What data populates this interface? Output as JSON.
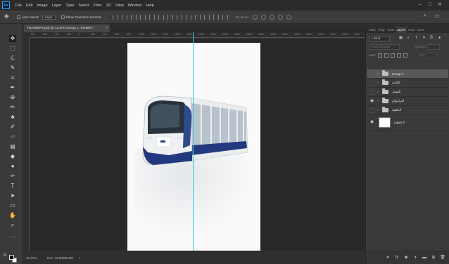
{
  "app": {
    "logo_text": "Ps"
  },
  "menu": [
    "File",
    "Edit",
    "Image",
    "Layer",
    "Type",
    "Select",
    "Filter",
    "3D",
    "View",
    "Window",
    "Help"
  ],
  "window_controls": [
    "–",
    "□",
    "✕"
  ],
  "options_bar": {
    "auto_select_label": "Auto-Select:",
    "auto_select_value": "Layer",
    "show_transform_label": "Show Transform Controls",
    "mode_3d_label": "3D Mode:"
  },
  "document_tab": {
    "title": "TRAMWAY.psd @ 12,5% (Group 1, RGB/8) *",
    "close": "×"
  },
  "ruler_ticks": [
    "800",
    "600",
    "400",
    "200",
    "0",
    "200",
    "400",
    "600",
    "800",
    "1000",
    "1200",
    "1400",
    "1600",
    "1800",
    "2000",
    "2200",
    "2400",
    "2600",
    "2800",
    "3000",
    "3200",
    "3400",
    "3600",
    "3800",
    "4000",
    "4200",
    "4400",
    "4600"
  ],
  "status_bar": {
    "zoom": "12,47%",
    "doc_info": "Doc: 44,9M/85,9M",
    "arrow": ">"
  },
  "panels": {
    "tabs": [
      "Histo",
      "Prop",
      "Swat",
      "Layers",
      "Para",
      "Char"
    ],
    "active_tab": "Layers",
    "kind_label": "Kind",
    "blend_mode": "Pass Through",
    "opacity_label": "Opacity:",
    "lock_label": "Lock:",
    "fill_label": "Fill:",
    "layers": [
      {
        "name": "Group 1",
        "type": "group",
        "visible": false,
        "selected": true
      },
      {
        "name": "الكتابة",
        "type": "group",
        "visible": false,
        "selected": false
      },
      {
        "name": "الشعار",
        "type": "group",
        "visible": false,
        "selected": false
      },
      {
        "name": "الترامواي",
        "type": "group",
        "visible": true,
        "selected": false
      },
      {
        "name": "الخلفية",
        "type": "group",
        "visible": false,
        "selected": false
      },
      {
        "name": "Layer 0",
        "type": "pixel",
        "visible": true,
        "selected": false
      }
    ]
  },
  "colors": {
    "accent_guide": "#3fc6d6",
    "tram_blue": "#23397f",
    "tram_white": "#eef0f2"
  }
}
